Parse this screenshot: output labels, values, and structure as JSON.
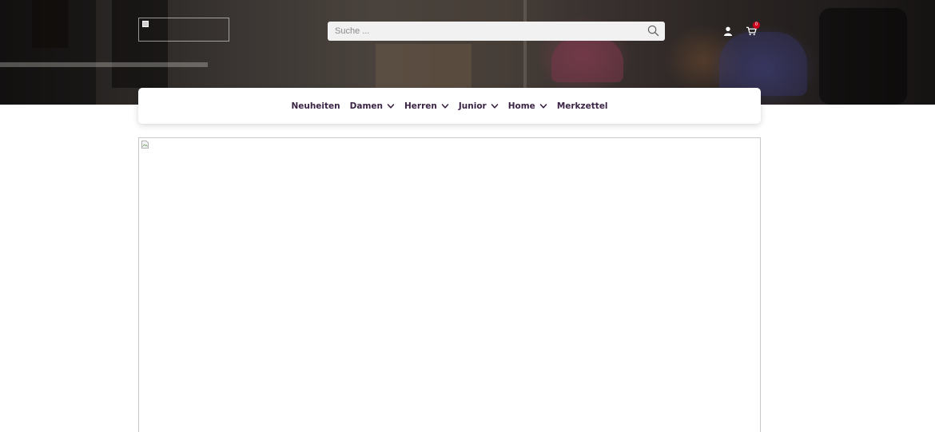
{
  "header": {
    "search": {
      "placeholder": "Suche ..."
    },
    "cart": {
      "count": "0"
    }
  },
  "nav": {
    "items": [
      {
        "label": "Neuheiten",
        "has_dropdown": false
      },
      {
        "label": "Damen",
        "has_dropdown": true
      },
      {
        "label": "Herren",
        "has_dropdown": true
      },
      {
        "label": "Junior",
        "has_dropdown": true
      },
      {
        "label": "Home",
        "has_dropdown": true
      },
      {
        "label": "Merkzettel",
        "has_dropdown": false
      }
    ]
  },
  "icons": {
    "logo": "broken-image-icon",
    "search": "search-icon",
    "account": "user-icon",
    "cart": "cart-icon",
    "dropdown": "chevron-down-icon",
    "content": "broken-image-icon"
  },
  "colors": {
    "nav_text": "#3b2545",
    "cart_badge": "#d0021b",
    "search_bg": "#f1f1f1"
  }
}
